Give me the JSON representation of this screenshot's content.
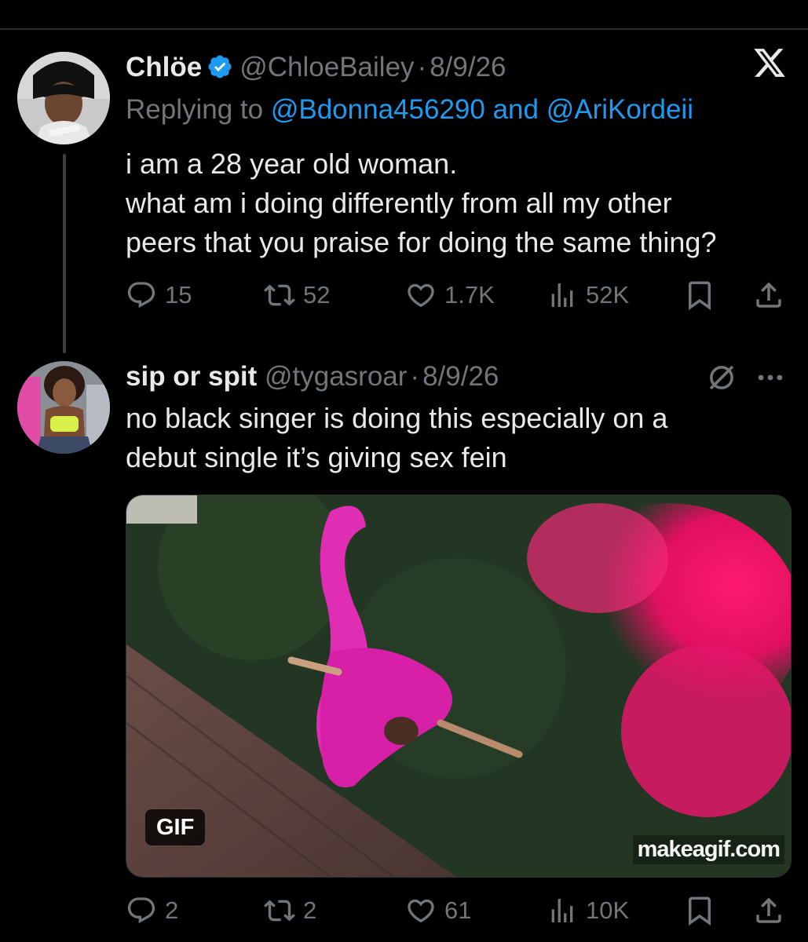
{
  "tweet1": {
    "display_name": "Chlöe",
    "handle": "@ChloeBailey",
    "dot": "·",
    "date": "8/9/26",
    "replying_prefix": "Replying to",
    "mention1": "@Bdonna456290",
    "and": "and",
    "mention2": "@AriKordeii",
    "text_lines": [
      "i am a 28 year old woman.",
      "what am i doing differently from all my other",
      "peers that you praise for doing the same thing?"
    ],
    "replies": "15",
    "reposts": "52",
    "likes": "1.7K",
    "views": "52K",
    "header_icon": "x-logo-icon"
  },
  "tweet2": {
    "display_name": "sip or spit",
    "handle": "@tygasroar",
    "dot": "·",
    "date": "8/9/26",
    "text_lines": [
      "no black singer is doing this especially on a",
      "debut single it’s giving sex fein"
    ],
    "media": {
      "badge": "GIF",
      "watermark": "makeagif.com"
    },
    "replies": "2",
    "reposts": "2",
    "likes": "61",
    "views": "10K"
  },
  "colors": {
    "background": "#000000",
    "text": "#e7e9ea",
    "muted": "#71767b",
    "accent": "#1d9bf0",
    "verified": "#1d9bf0"
  },
  "icons": [
    "reply-icon",
    "repost-icon",
    "like-icon",
    "views-icon",
    "bookmark-icon",
    "share-icon",
    "mute-icon",
    "more-icon",
    "verified-badge-icon"
  ]
}
